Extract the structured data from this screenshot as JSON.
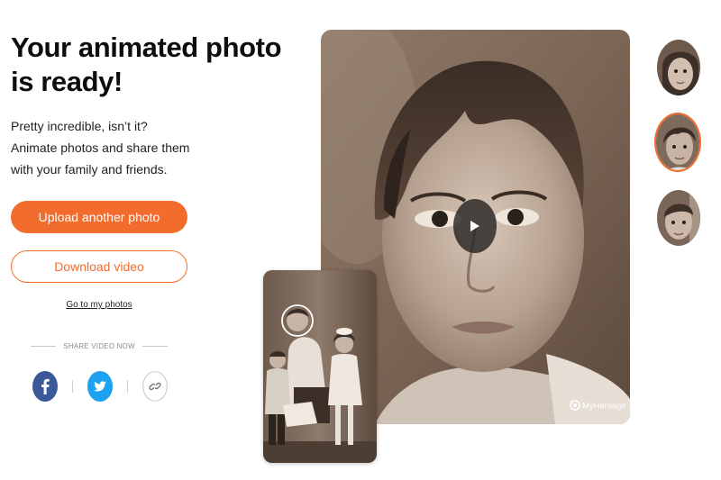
{
  "page": {
    "title": "Your animated photo is ready!",
    "description": "Pretty incredible, isn’t it? Animate photos and share them with your family and friends."
  },
  "actions": {
    "upload_label": "Upload another photo",
    "download_label": "Download video",
    "my_photos_label": "Go to my photos"
  },
  "share": {
    "label": "SHARE VIDEO NOW",
    "buttons": [
      "facebook-icon",
      "twitter-icon",
      "link-icon"
    ]
  },
  "player": {
    "watermark": "MyHeritage"
  },
  "avatars": [
    {
      "name": "girl-face",
      "selected": false
    },
    {
      "name": "woman-face",
      "selected": true
    },
    {
      "name": "boy-face",
      "selected": false
    }
  ],
  "colors": {
    "accent": "#f26c2e",
    "facebook": "#3b5998",
    "twitter": "#1da1f2",
    "photo_tone": "#7a6656"
  }
}
